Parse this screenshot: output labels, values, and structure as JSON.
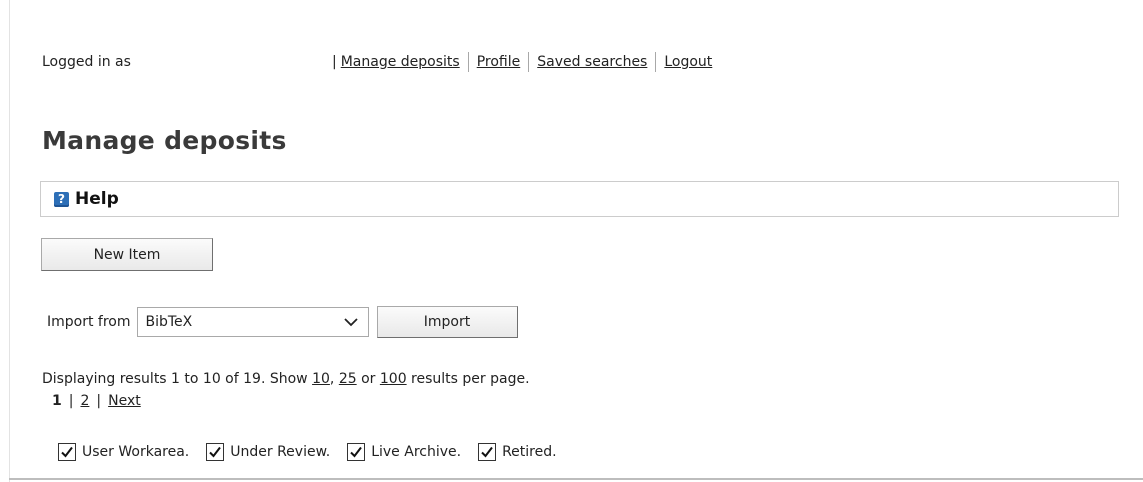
{
  "header": {
    "logged_in_text": "Logged in as",
    "pipe": "|",
    "nav": [
      {
        "label": "Manage deposits"
      },
      {
        "label": "Profile"
      },
      {
        "label": "Saved searches"
      },
      {
        "label": "Logout"
      }
    ]
  },
  "main": {
    "title": "Manage deposits",
    "help": {
      "icon": "question-icon",
      "icon_glyph": "?",
      "label": "Help"
    },
    "new_item_label": "New Item",
    "import": {
      "label": "Import from",
      "selected": "BibTeX",
      "button_label": "Import"
    },
    "results": {
      "prefix": "Displaying results 1 to 10 of 19. Show ",
      "page_sizes": [
        "10",
        "25",
        "100"
      ],
      "sep1": ", ",
      "sep2": " or ",
      "suffix": " results per page."
    },
    "pager": {
      "current": "1",
      "separator": "|",
      "page2": "2",
      "next": "Next"
    },
    "filters": [
      {
        "label": "User Workarea.",
        "checked": true
      },
      {
        "label": "Under Review.",
        "checked": true
      },
      {
        "label": "Live Archive.",
        "checked": true
      },
      {
        "label": "Retired.",
        "checked": true
      }
    ]
  },
  "colors": {
    "help_icon_bg": "#2d6fb7",
    "text": "#222222",
    "title": "#3a3a3a"
  }
}
